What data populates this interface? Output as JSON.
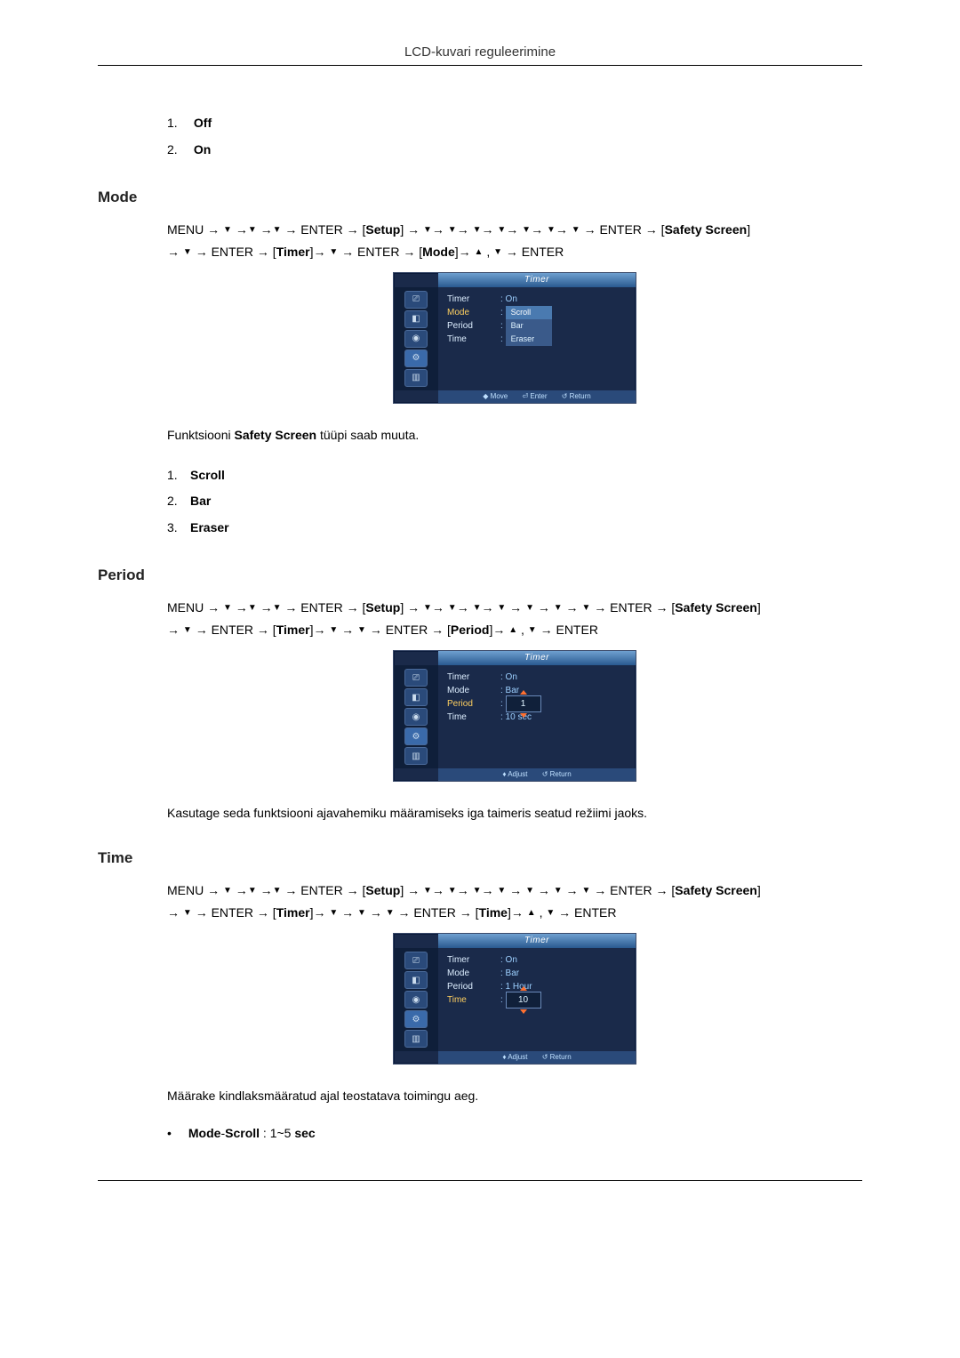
{
  "header": {
    "title": "LCD-kuvari reguleerimine"
  },
  "list_off_on": {
    "items": [
      {
        "num": "1.",
        "label": "Off"
      },
      {
        "num": "2.",
        "label": "On"
      }
    ]
  },
  "mode": {
    "heading": "Mode",
    "nav": {
      "p1": "MENU →",
      "p2": "→",
      "p3": "→",
      "p4": "→ ENTER → [",
      "setup": "Setup",
      "p5": "] →",
      "p6": "→",
      "p7": "→",
      "p8": "→",
      "p9": "→",
      "p10": "→",
      "p11": "→",
      "p12": "→ ENTER → [",
      "safety": "Safety Screen",
      "p13": "]",
      "line2a": "→",
      "line2b": "→ ENTER → [",
      "timer": "Timer",
      "line2c": "]→",
      "line2d": "→ ENTER → [",
      "modek": "Mode",
      "line2e": "]→",
      "line2f": ",",
      "line2g": "→ ENTER"
    },
    "osd": {
      "title": "Timer",
      "rows": [
        {
          "label": "Timer",
          "value": ": On"
        },
        {
          "label": "Mode",
          "value": ""
        },
        {
          "label": "Period",
          "value": ""
        },
        {
          "label": "Time",
          "value": ""
        }
      ],
      "options": [
        "Scroll",
        "Bar",
        "Eraser"
      ],
      "footer": {
        "move": "◆ Move",
        "enter": "⏎ Enter",
        "ret": "↺ Return"
      }
    },
    "para_pre": "Funktsiooni ",
    "para_bold": "Safety Screen",
    "para_post": " tüüpi saab muuta.",
    "list": [
      {
        "num": "1.",
        "label": "Scroll"
      },
      {
        "num": "2.",
        "label": "Bar"
      },
      {
        "num": "3.",
        "label": "Eraser"
      }
    ]
  },
  "period": {
    "heading": "Period",
    "nav": {
      "p1": "MENU →",
      "p4": "→ ENTER → [",
      "setup": "Setup",
      "p5": "] →",
      "p12": "→ ENTER → [",
      "safety": "Safety Screen",
      "p13": "]",
      "line2a": "→",
      "line2b": "→ ENTER → [",
      "timer": "Timer",
      "line2c": "]→",
      "line2d": "→",
      "line2e": "→ ENTER → [",
      "periodk": "Period",
      "line2f": "]→",
      "line2g": ",",
      "line2h": "→ ENTER"
    },
    "osd": {
      "title": "Timer",
      "rows": [
        {
          "label": "Timer",
          "value": ": On"
        },
        {
          "label": "Mode",
          "value": ": Bar"
        },
        {
          "label": "Period",
          "value": "1"
        },
        {
          "label": "Time",
          "value": ": 10 sec"
        }
      ],
      "footer": {
        "adjust": "♦ Adjust",
        "ret": "↺ Return"
      }
    },
    "para": "Kasutage seda funktsiooni ajavahemiku määramiseks iga taimeris seatud režiimi jaoks."
  },
  "time": {
    "heading": "Time",
    "nav": {
      "p1": "MENU →",
      "p4": "→ ENTER → [",
      "setup": "Setup",
      "p5": "] →",
      "p12": "→ ENTER → [",
      "safety": "Safety Screen",
      "p13": "]",
      "line2a": "→",
      "line2b": "→ ENTER → [",
      "timer": "Timer",
      "line2c": "]→",
      "line2d": "→",
      "line2e": "→",
      "line2f": "→ ENTER → [",
      "timek": "Time",
      "line2g": "]→",
      "line2h": ",",
      "line2i": "→ ENTER"
    },
    "osd": {
      "title": "Timer",
      "rows": [
        {
          "label": "Timer",
          "value": ": On"
        },
        {
          "label": "Mode",
          "value": ": Bar"
        },
        {
          "label": "Period",
          "value": ": 1 Hour"
        },
        {
          "label": "Time",
          "value": "10"
        }
      ],
      "footer": {
        "adjust": "♦ Adjust",
        "ret": "↺ Return"
      }
    },
    "para": "Määrake kindlaksmääratud ajal teostatava toimingu aeg.",
    "bullet_pre": "Mode",
    "bullet_mid": "-",
    "bullet_bold2": "Scroll",
    "bullet_post": " : 1~5 ",
    "bullet_sec": "sec"
  }
}
